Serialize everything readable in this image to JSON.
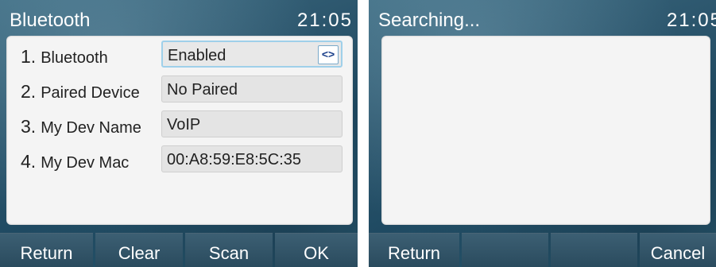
{
  "left_screen": {
    "title": "Bluetooth",
    "clock": "21:05",
    "rows": [
      {
        "num": "1.",
        "label": "Bluetooth",
        "value": "Enabled",
        "switch_glyph": "<>"
      },
      {
        "num": "2.",
        "label": "Paired Device",
        "value": "No Paired"
      },
      {
        "num": "3.",
        "label": "My Dev Name",
        "value": "VoIP"
      },
      {
        "num": "4.",
        "label": "My Dev Mac",
        "value": "00:A8:59:E8:5C:35"
      }
    ],
    "softkeys": [
      "Return",
      "Clear",
      "Scan",
      "OK"
    ]
  },
  "right_screen": {
    "title": "Searching...",
    "clock": "21:05",
    "softkeys": [
      "Return",
      "",
      "",
      "Cancel"
    ]
  },
  "colors": {
    "background_blue": "#2c566d",
    "panel": "#f4f4f4",
    "field": "#e4e4e4",
    "active_border": "#9fd0ea",
    "text_white": "#ffffff"
  },
  "icons": {
    "switch": "left-right-arrows-icon"
  }
}
